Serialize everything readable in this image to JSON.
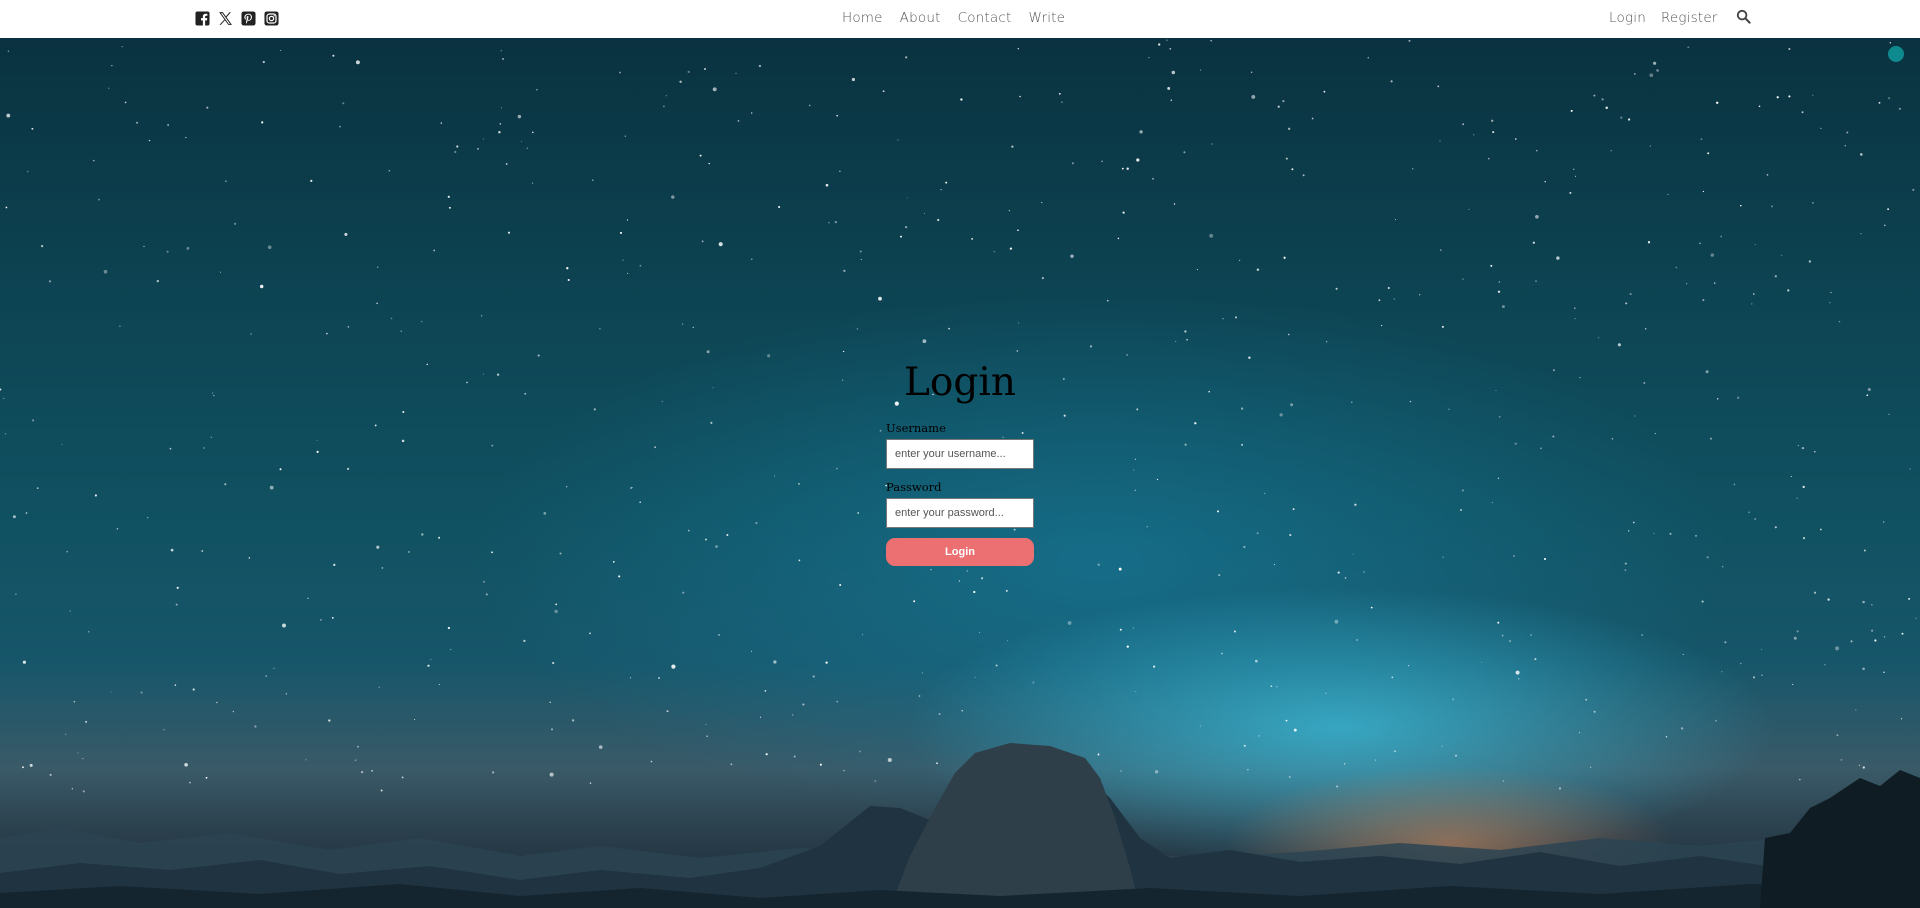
{
  "header": {
    "social": [
      {
        "icon": "facebook-square-icon"
      },
      {
        "icon": "x-twitter-icon"
      },
      {
        "icon": "pinterest-square-icon"
      },
      {
        "icon": "instagram-square-icon"
      }
    ],
    "nav": {
      "home": "Home",
      "about": "About",
      "contact": "Contact",
      "write": "Write"
    },
    "auth": {
      "login": "Login",
      "register": "Register"
    },
    "search_icon": "search-icon"
  },
  "login_form": {
    "title": "Login",
    "username_label": "Username",
    "username_placeholder": "enter your username...",
    "password_label": "Password",
    "password_placeholder": "enter your password...",
    "submit_label": "Login"
  },
  "colors": {
    "topbar_bg": "#ffffff",
    "nav_text": "#555555",
    "button_bg": "#ec6f72",
    "button_text": "#ffffff",
    "indicator_dot": "#0e8a8e"
  }
}
